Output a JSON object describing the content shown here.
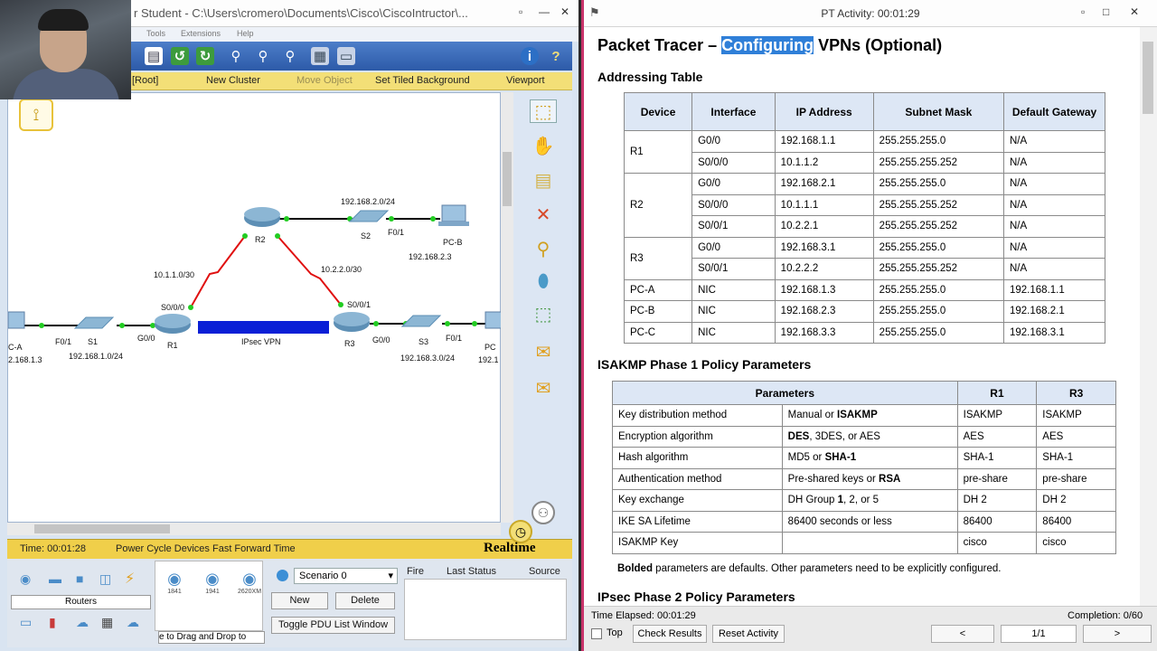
{
  "left_window": {
    "title": "r Student - C:\\Users\\cromero\\Documents\\Cisco\\CiscoIntructor\\...",
    "menu": [
      "Tools",
      "Extensions",
      "Help"
    ],
    "logical_bar": {
      "root": "[Root]",
      "new_cluster": "New Cluster",
      "move_object": "Move Object",
      "set_tiled_background": "Set Tiled Background",
      "viewport": "Viewport"
    },
    "topology": {
      "labels": {
        "s2_net": "192.168.2.0/24",
        "r2": "R2",
        "s2": "S2",
        "f01_s2": "F0/1",
        "pcb": "PC-B",
        "pcb_ip": "192.168.2.3",
        "link_r1r2": "10.1.1.0/30",
        "link_r2r3": "10.2.2.0/30",
        "s000_r1": "S0/0/0",
        "s001_r3": "S0/0/1",
        "ipsec": "IPsec VPN",
        "pca": "C-A",
        "pca_ip": "2.168.1.3",
        "f01_s1": "F0/1",
        "s1": "S1",
        "s1_net": "192.168.1.0/24",
        "g00_r1": "G0/0",
        "r1": "R1",
        "r3": "R3",
        "g00_r3": "G0/0",
        "s3": "S3",
        "f01_s3": "F0/1",
        "s3_net": "192.168.3.0/24",
        "pcc": "PC",
        "pcc_ip": "192.1"
      }
    },
    "status": {
      "time": "Time: 00:01:28",
      "power_cycle": "Power Cycle Devices  Fast Forward Time",
      "mode": "Realtime"
    },
    "device_panel": {
      "category": "Routers",
      "thumbs": [
        "1841",
        "1941",
        "2620XM"
      ],
      "drag_hint": "e to Drag and Drop to"
    },
    "scenario": {
      "selected": "Scenario 0",
      "new": "New",
      "delete": "Delete",
      "toggle": "Toggle PDU List Window"
    },
    "pdu_columns": [
      "Fire",
      "Last Status",
      "Source"
    ]
  },
  "right_window": {
    "title": "PT Activity: 00:01:29",
    "doc_title_pre": "Packet Tracer – ",
    "doc_title_hl": "Configuring",
    "doc_title_post": " VPNs (Optional)",
    "addressing_heading": "Addressing Table",
    "addressing_headers": [
      "Device",
      "Interface",
      "IP Address",
      "Subnet Mask",
      "Default Gateway"
    ],
    "addressing_rows": [
      {
        "device": "R1",
        "span": 2,
        "cells": [
          [
            "G0/0",
            "192.168.1.1",
            "255.255.255.0",
            "N/A"
          ],
          [
            "S0/0/0",
            "10.1.1.2",
            "255.255.255.252",
            "N/A"
          ]
        ]
      },
      {
        "device": "R2",
        "span": 3,
        "cells": [
          [
            "G0/0",
            "192.168.2.1",
            "255.255.255.0",
            "N/A"
          ],
          [
            "S0/0/0",
            "10.1.1.1",
            "255.255.255.252",
            "N/A"
          ],
          [
            "S0/0/1",
            "10.2.2.1",
            "255.255.255.252",
            "N/A"
          ]
        ]
      },
      {
        "device": "R3",
        "span": 2,
        "cells": [
          [
            "G0/0",
            "192.168.3.1",
            "255.255.255.0",
            "N/A"
          ],
          [
            "S0/0/1",
            "10.2.2.2",
            "255.255.255.252",
            "N/A"
          ]
        ]
      },
      {
        "device": "PC-A",
        "span": 1,
        "cells": [
          [
            "NIC",
            "192.168.1.3",
            "255.255.255.0",
            "192.168.1.1"
          ]
        ]
      },
      {
        "device": "PC-B",
        "span": 1,
        "cells": [
          [
            "NIC",
            "192.168.2.3",
            "255.255.255.0",
            "192.168.2.1"
          ]
        ]
      },
      {
        "device": "PC-C",
        "span": 1,
        "cells": [
          [
            "NIC",
            "192.168.3.3",
            "255.255.255.0",
            "192.168.3.1"
          ]
        ]
      }
    ],
    "isakmp_heading": "ISAKMP Phase 1 Policy Parameters",
    "isakmp_headers": [
      "Parameters",
      "R1",
      "R3"
    ],
    "isakmp_rows": [
      {
        "param": "Key distribution method",
        "options_html": "Manual or <b>ISAKMP</b>",
        "r1": "ISAKMP",
        "r3": "ISAKMP"
      },
      {
        "param": "Encryption algorithm",
        "options_html": "<b>DES</b>, 3DES, or AES",
        "r1": "AES",
        "r3": "AES"
      },
      {
        "param": "Hash algorithm",
        "options_html": "MD5 or <b>SHA-1</b>",
        "r1": "SHA-1",
        "r3": "SHA-1"
      },
      {
        "param": "Authentication method",
        "options_html": "Pre-shared keys or <b>RSA</b>",
        "r1": "pre-share",
        "r3": "pre-share"
      },
      {
        "param": "Key exchange",
        "options_html": "DH Group <b>1</b>, 2, or 5",
        "r1": "DH 2",
        "r3": "DH 2"
      },
      {
        "param": "IKE SA Lifetime",
        "options_html": "86400 seconds or less",
        "r1": "86400",
        "r3": "86400"
      },
      {
        "param": "ISAKMP Key",
        "options_html": "",
        "r1": "cisco",
        "r3": "cisco"
      }
    ],
    "note_bold": "Bolded",
    "note_rest": " parameters are defaults. Other parameters need to be explicitly configured.",
    "ipsec_heading": "IPsec Phase 2 Policy Parameters",
    "footer": {
      "elapsed": "Time Elapsed: 00:01:29",
      "completion": "Completion: 0/60",
      "top": "Top",
      "check_results": "Check Results",
      "reset_activity": "Reset Activity",
      "prev": "<",
      "page": "1/1",
      "next": ">"
    }
  }
}
